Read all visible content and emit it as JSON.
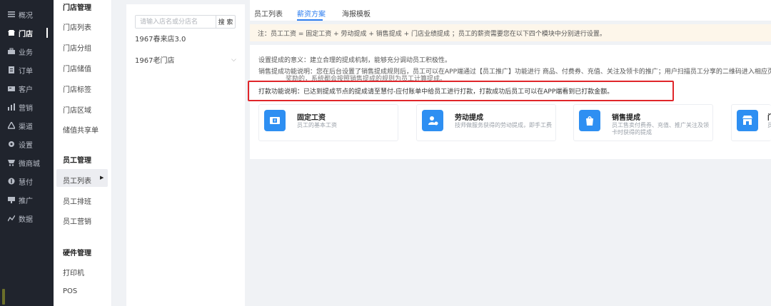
{
  "nav": {
    "items": [
      {
        "label": "概况",
        "icon": "list-icon"
      },
      {
        "label": "门店",
        "icon": "store-icon"
      },
      {
        "label": "业务",
        "icon": "briefcase-icon"
      },
      {
        "label": "订单",
        "icon": "order-icon"
      },
      {
        "label": "客户",
        "icon": "customer-icon"
      },
      {
        "label": "营销",
        "icon": "bar-chart-icon"
      },
      {
        "label": "渠道",
        "icon": "channel-icon"
      },
      {
        "label": "设置",
        "icon": "gear-icon"
      },
      {
        "label": "微商城",
        "icon": "mall-icon"
      },
      {
        "label": "慧付",
        "icon": "pay-icon"
      },
      {
        "label": "推广",
        "icon": "promote-icon"
      },
      {
        "label": "数据",
        "icon": "data-icon"
      }
    ]
  },
  "submenu": {
    "store_header": "门店管理",
    "store_items": [
      "门店列表",
      "门店分组",
      "门店储值",
      "门店标签",
      "门店区域",
      "储值共享单"
    ],
    "staff_header": "员工管理",
    "staff_items": [
      "员工列表",
      "员工排班",
      "员工营销"
    ],
    "hardware_header": "硬件管理",
    "hardware_items": [
      "打印机",
      "POS"
    ]
  },
  "stores": {
    "search_placeholder": "请输入店名或分店名",
    "search_button": "搜 索",
    "items": [
      "1967春来店3.0",
      "1967老门店"
    ]
  },
  "tabs": [
    "员工列表",
    "薪资方案",
    "海报模板"
  ],
  "note": "注：员工工资 = 固定工资 + 劳动提成 + 销售提成 + 门店业绩提成 ；员工的薪资需要您在以下四个模块中分别进行设置。",
  "descriptions": [
    "设置提成的意义：建立合理的提成机制，能够充分调动员工积极性。",
    "销售提成功能说明：您在后台设置了销售提成规则后，员工可以在APP端通过【员工推广】功能进行 商品、付费券、充值、关注及领卡的推广；用户扫描员工分享的二维码进入相应页面后，当次",
    "奖励的，系统都会按照销售提成的规则为员工计算提成。",
    "打款功能说明：已达到提成节点的提成请至慧付-应付账单中给员工进行打款，打款成功后员工可以在APP端看到已打款金额。"
  ],
  "tiles": [
    {
      "title": "固定工资",
      "desc": "员工的基本工资",
      "icon": "salary-icon"
    },
    {
      "title": "劳动提成",
      "desc": "技师做服务获得的劳动提成，即手工费",
      "icon": "labor-icon"
    },
    {
      "title": "销售提成",
      "desc": "员工售卖付费券、充值、推广关注及领卡时获得的提成",
      "icon": "sales-icon"
    },
    {
      "title": "门",
      "desc": "员",
      "icon": "shop-icon"
    }
  ],
  "colors": {
    "accent": "#2f7ff0",
    "highlight_border": "#e0262a",
    "note_bg": "#fdf6ea",
    "nav_bg": "#20242d",
    "tile_icon_bg": "#2e8ff2"
  }
}
